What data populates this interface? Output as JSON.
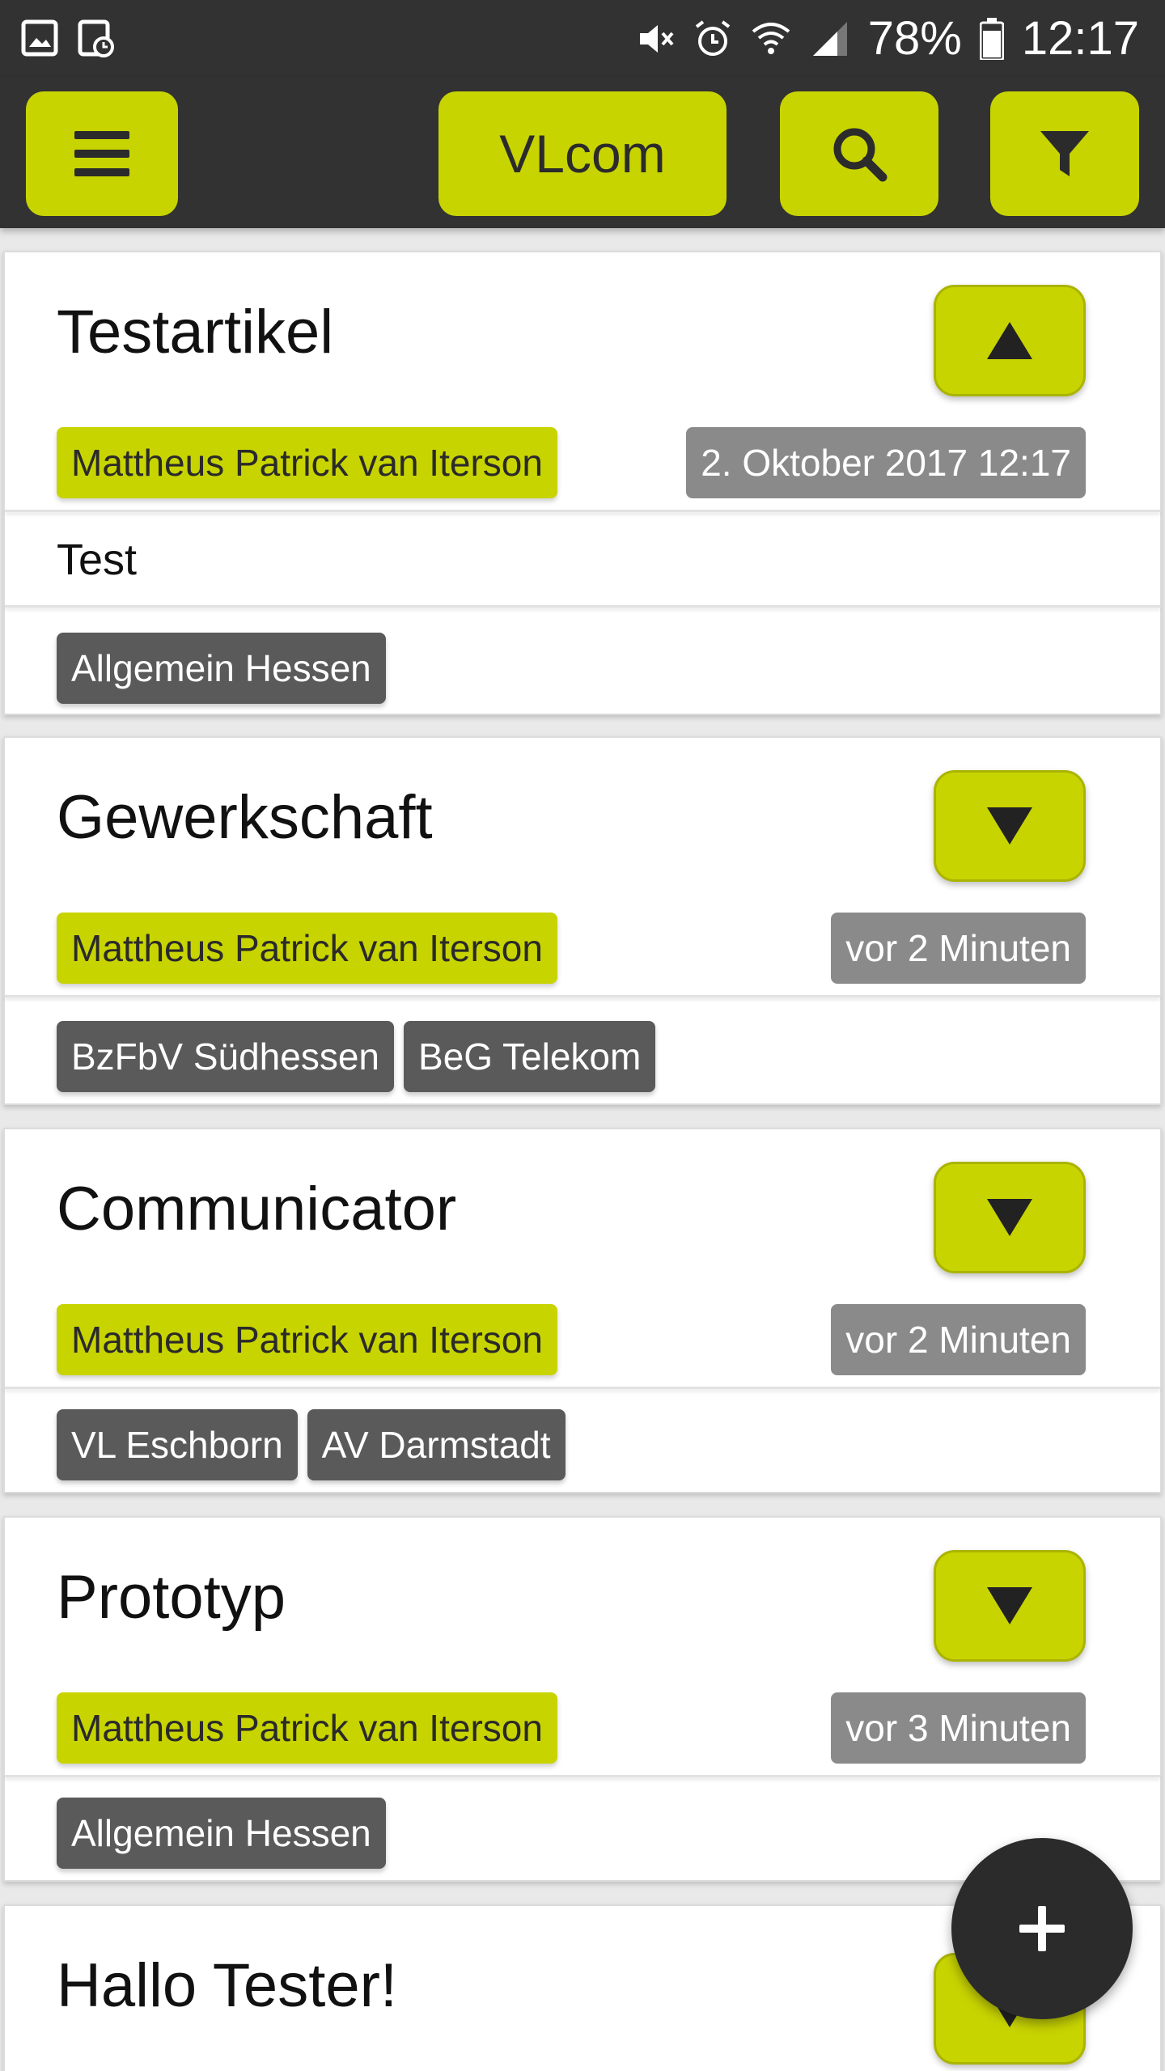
{
  "status_bar": {
    "battery": "78%",
    "time": "12:17",
    "icons": [
      "image-icon",
      "screenshot-clock-icon",
      "mute-icon",
      "alarm-icon",
      "wifi-icon",
      "signal-icon",
      "battery-icon"
    ]
  },
  "app_bar": {
    "title": "VLcom",
    "menu_icon": "menu-icon",
    "search_icon": "search-icon",
    "filter_icon": "filter-icon"
  },
  "colors": {
    "accent": "#c8d400",
    "dark": "#323232",
    "date_chip": "#8a8a8a",
    "tag": "#5a5a5a"
  },
  "articles": [
    {
      "title": "Testartikel",
      "expanded": true,
      "toggle_icon": "chevron-up-icon",
      "author": "Mattheus Patrick van Iterson",
      "date": "2. Oktober 2017 12:17",
      "body": "Test",
      "tags": [
        "Allgemein Hessen"
      ]
    },
    {
      "title": "Gewerkschaft",
      "expanded": false,
      "toggle_icon": "chevron-down-icon",
      "author": "Mattheus Patrick van Iterson",
      "date": "vor 2 Minuten",
      "tags": [
        "BzFbV Südhessen",
        "BeG Telekom"
      ]
    },
    {
      "title": "Communicator",
      "expanded": false,
      "toggle_icon": "chevron-down-icon",
      "author": "Mattheus Patrick van Iterson",
      "date": "vor 2 Minuten",
      "tags": [
        "VL Eschborn",
        "AV Darmstadt"
      ]
    },
    {
      "title": "Prototyp",
      "expanded": false,
      "toggle_icon": "chevron-down-icon",
      "author": "Mattheus Patrick van Iterson",
      "date": "vor 3 Minuten",
      "tags": [
        "Allgemein Hessen"
      ]
    },
    {
      "title": "Hallo Tester!",
      "expanded": false,
      "toggle_icon": "chevron-down-icon"
    }
  ],
  "fab": {
    "label": "+",
    "icon": "plus-icon"
  }
}
